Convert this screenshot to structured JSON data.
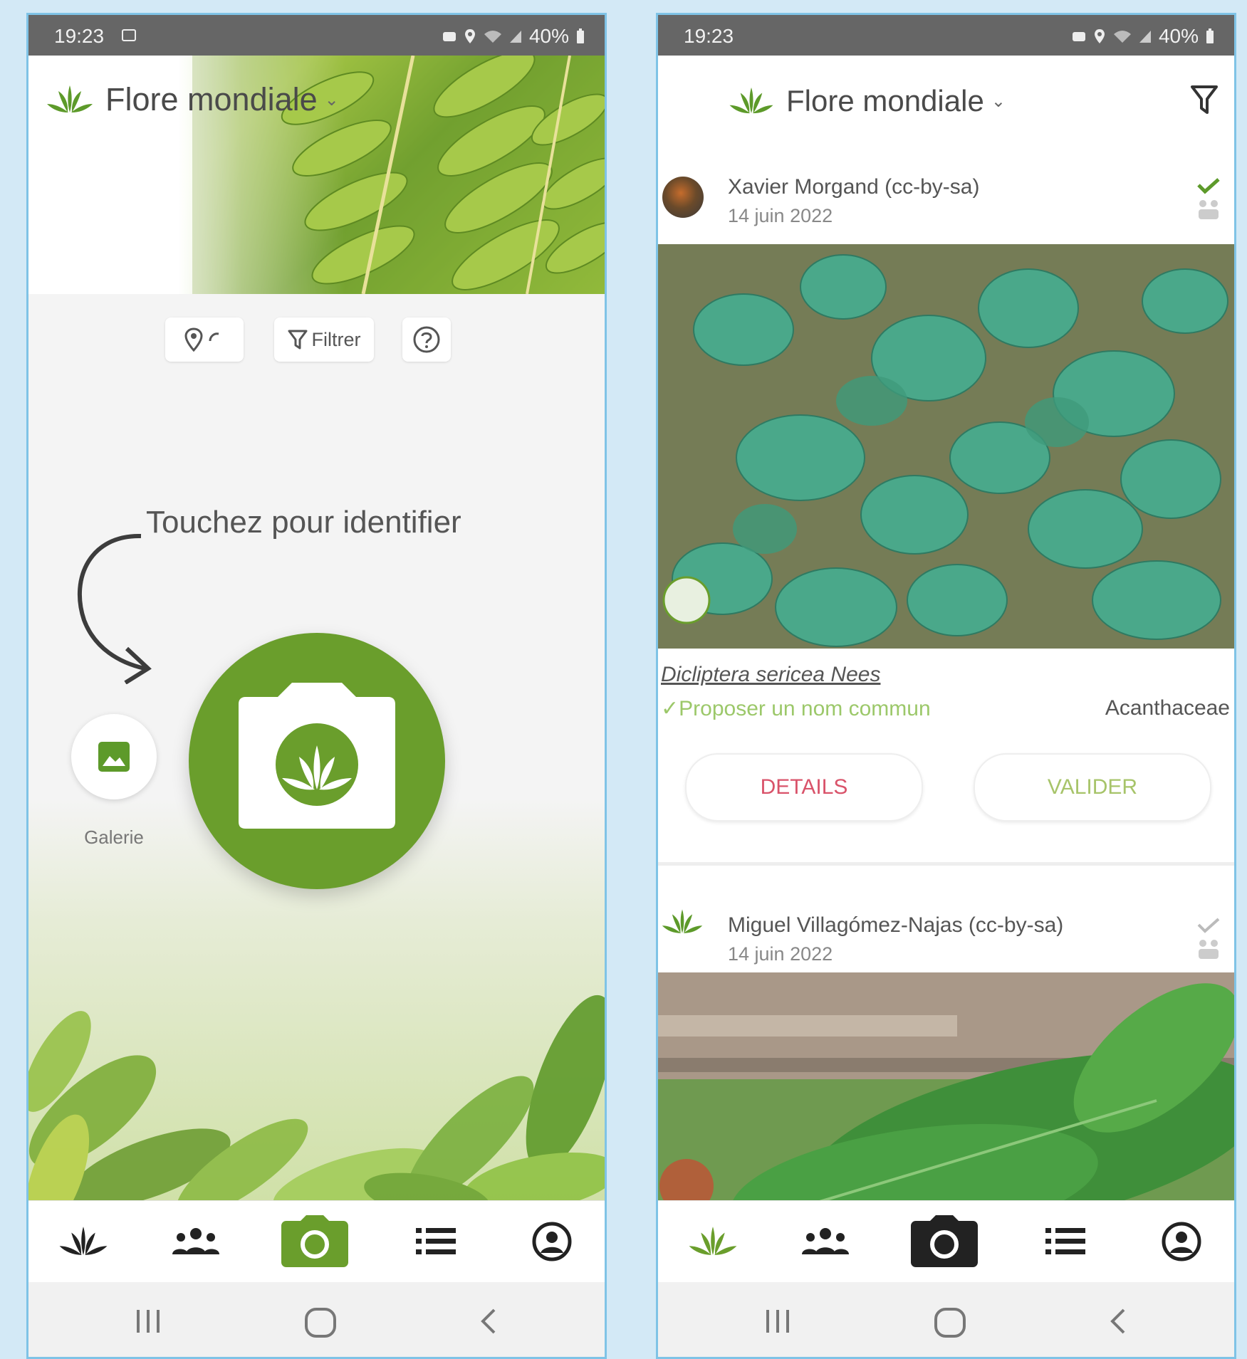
{
  "left": {
    "status": {
      "time": "19:23",
      "battery": "40%"
    },
    "app_title": "Flore mondiale",
    "toolbar": {
      "filter_label": "Filtrer"
    },
    "hint": "Touchez pour identifier",
    "gallery_label": "Galerie",
    "colors": {
      "brand_green": "#6a9e2c"
    }
  },
  "right": {
    "status": {
      "time": "19:23",
      "battery": "40%"
    },
    "app_title": "Flore mondiale",
    "posts": [
      {
        "author": "Xavier Morgand (cc-by-sa)",
        "date": "14 juin 2022",
        "species": "Dicliptera sericea Nees",
        "common_name": "✓Proposer un nom commun",
        "family": "Acanthaceae",
        "details_label": "DETAILS",
        "validate_label": "VALIDER"
      },
      {
        "author": "Miguel Villagómez-Najas (cc-by-sa)",
        "date": "14 juin 2022"
      }
    ]
  },
  "nav_icons": [
    "plant-icon",
    "community-icon",
    "camera-icon",
    "list-icon",
    "profile-icon"
  ],
  "sys_nav_icons": [
    "recent-apps-icon",
    "home-icon",
    "back-icon"
  ]
}
